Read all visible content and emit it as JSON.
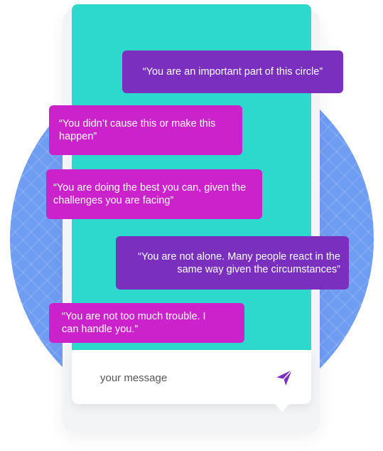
{
  "messages": [
    {
      "text": "“You are an important part of this circle”",
      "color": "#7b2fbe"
    },
    {
      "text": "“You didn’t cause this or make this\n happen”",
      "color": "#cc22cc"
    },
    {
      "text": "“You are doing the best you can, given the\n challenges you are facing”",
      "color": "#cc22cc"
    },
    {
      "text": "“You are not alone. Many people react in the\n same way given the circumstances”",
      "color": "#7b2fbe"
    },
    {
      "text": "“You are not too much trouble. I\n can handle you.”",
      "color": "#cc22cc"
    }
  ],
  "input": {
    "placeholder": "your message",
    "value": ""
  },
  "send": {
    "icon": "paper-plane-icon",
    "color": "#7b2fbe"
  },
  "colors": {
    "chat_background": "#2dd9cd",
    "circle": "#6f9df2",
    "purple": "#7b2fbe",
    "magenta": "#cc22cc"
  }
}
